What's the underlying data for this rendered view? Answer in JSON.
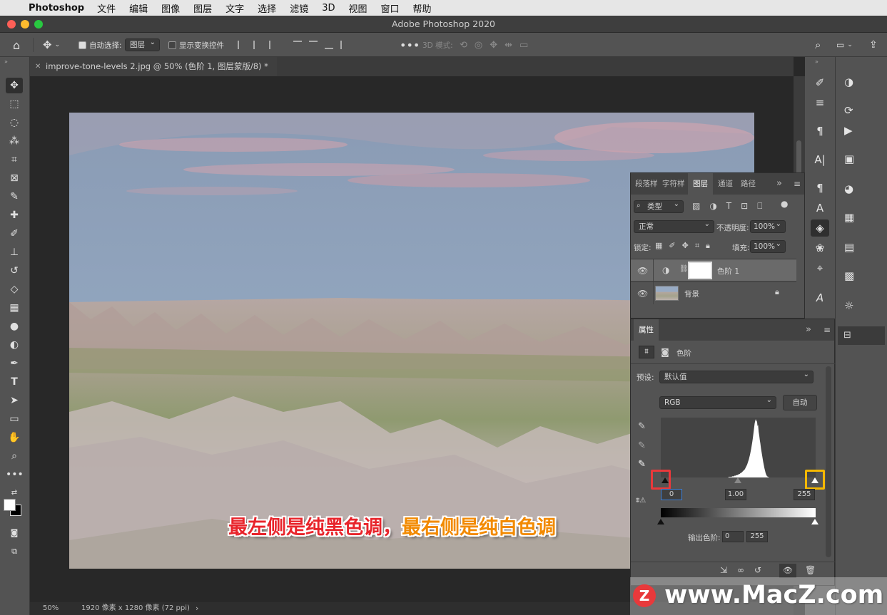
{
  "menubar": {
    "app": "Photoshop",
    "items": [
      "文件",
      "编辑",
      "图像",
      "图层",
      "文字",
      "选择",
      "滤镜",
      "3D",
      "视图",
      "窗口",
      "帮助"
    ]
  },
  "window": {
    "title": "Adobe Photoshop 2020"
  },
  "options": {
    "auto_select_label": "自动选择:",
    "auto_select_value": "图层",
    "show_transform_label": "显示变换控件",
    "mode_3d_label": "3D 模式:"
  },
  "document": {
    "tab": "improve-tone-levels 2.jpg @ 50% (色阶 1, 图层蒙版/8) *",
    "zoom": "50%",
    "info": "1920 像素 x 1280 像素 (72 ppi)"
  },
  "layers_panel": {
    "tabs": [
      "段落样",
      "字符样",
      "图层",
      "通道",
      "路径"
    ],
    "active_tab": "图层",
    "filter_kind": "类型",
    "blend_mode": "正常",
    "opacity_label": "不透明度:",
    "opacity": "100%",
    "lock_label": "锁定:",
    "fill_label": "填充:",
    "fill": "100%",
    "layers": [
      {
        "name": "色阶 1"
      },
      {
        "name": "背景"
      }
    ]
  },
  "properties_panel": {
    "title": "属性",
    "adjustment": "色阶",
    "preset_label": "预设:",
    "preset_value": "默认值",
    "channel": "RGB",
    "auto_button": "自动",
    "input_black": "0",
    "input_gamma": "1.00",
    "input_white": "255",
    "output_label": "输出色阶:",
    "output_black": "0",
    "output_white": "255"
  },
  "caption": {
    "part1": "最左侧是纯黑色调，",
    "part2": "最右侧是纯白色调"
  },
  "watermark": {
    "text": "www.MacZ.com",
    "logo": "Z"
  },
  "colors": {
    "red_highlight": "#e8393b",
    "yellow_highlight": "#f5b800",
    "caption_red": "#e8242b",
    "caption_orange": "#f28a00",
    "sky": "#8fa3bd"
  },
  "histogram_bins": [
    0,
    0,
    0,
    0,
    0,
    0,
    0,
    0,
    0,
    0,
    0,
    0,
    0,
    0,
    0,
    0,
    0,
    0,
    0,
    0,
    0,
    0,
    0,
    0,
    0,
    0,
    0,
    0,
    0,
    0,
    0,
    0,
    0,
    0,
    0,
    0,
    0,
    0,
    0,
    0,
    0,
    0,
    0,
    0,
    0,
    0,
    0,
    0,
    0,
    0,
    0,
    0,
    0,
    0,
    0,
    0,
    0,
    0,
    0,
    0,
    0,
    0,
    0,
    0,
    0,
    0,
    0,
    0,
    0,
    0,
    0,
    0,
    0,
    0,
    0,
    0,
    0,
    0,
    0,
    0,
    0,
    0,
    0,
    0,
    0,
    0,
    0,
    0,
    0,
    0,
    0,
    0,
    0,
    0,
    0,
    0,
    0,
    0,
    0,
    0,
    0,
    0,
    0,
    0,
    0,
    0,
    0,
    0,
    0,
    0,
    0,
    0,
    0,
    0,
    0,
    0,
    0,
    0,
    1,
    1,
    1,
    1,
    1,
    1,
    2,
    2,
    2,
    2,
    3,
    3,
    3,
    4,
    4,
    4,
    5,
    5,
    6,
    6,
    7,
    8,
    8,
    9,
    10,
    11,
    12,
    13,
    14,
    16,
    18,
    20,
    22,
    25,
    28,
    31,
    35,
    39,
    44,
    49,
    55,
    61,
    68,
    76,
    84,
    92,
    97,
    100,
    95,
    98,
    88,
    90,
    78,
    72,
    64,
    58,
    50,
    44,
    38,
    32,
    26,
    21,
    16,
    12,
    8,
    5,
    3,
    2,
    1,
    1,
    0,
    0,
    0,
    0,
    0,
    0,
    0,
    0,
    0,
    0,
    0,
    0,
    0,
    0,
    0,
    0,
    0,
    0,
    0,
    0,
    0,
    0,
    0,
    0,
    0,
    0,
    0,
    0,
    0,
    0,
    0,
    0,
    0,
    0,
    0,
    0,
    0,
    0,
    0,
    0,
    0,
    0,
    0,
    0,
    0,
    0,
    0,
    0,
    0,
    0,
    0,
    0,
    0,
    0,
    0,
    0,
    0,
    0,
    0,
    0,
    0,
    0,
    0,
    0,
    0,
    0,
    0,
    0,
    0,
    0,
    0,
    0,
    0,
    0,
    0,
    0,
    0,
    0,
    0,
    0,
    0,
    0
  ]
}
